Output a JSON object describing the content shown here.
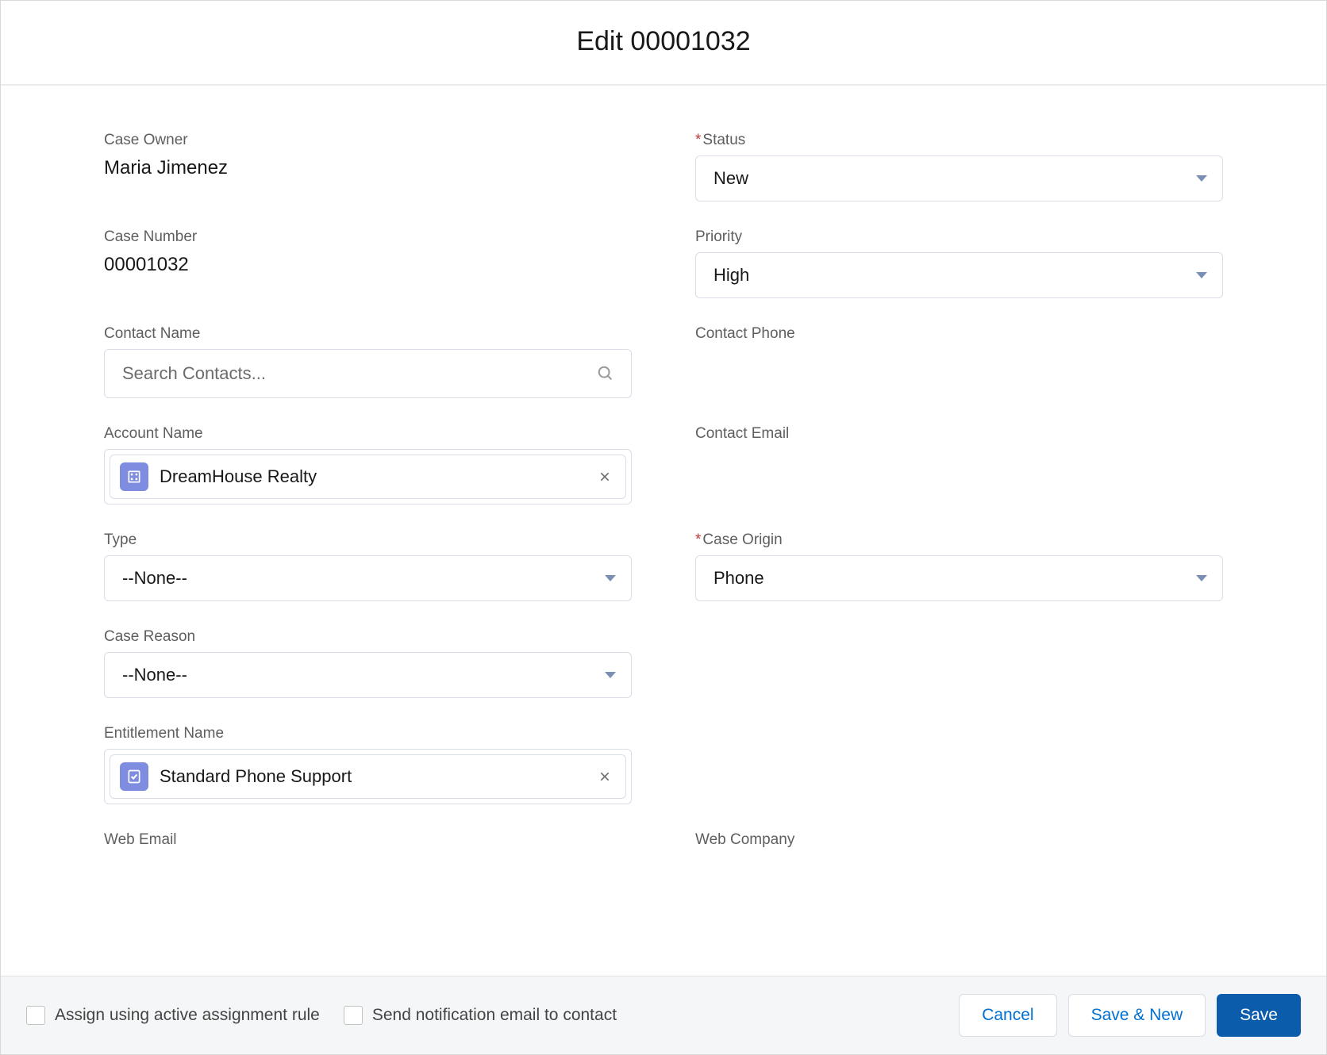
{
  "header": {
    "title": "Edit 00001032"
  },
  "fields": {
    "case_owner": {
      "label": "Case Owner",
      "value": "Maria Jimenez"
    },
    "status": {
      "label": "Status",
      "value": "New",
      "required": true
    },
    "case_number": {
      "label": "Case Number",
      "value": "00001032"
    },
    "priority": {
      "label": "Priority",
      "value": "High"
    },
    "contact_name": {
      "label": "Contact Name",
      "placeholder": "Search Contacts..."
    },
    "contact_phone": {
      "label": "Contact Phone",
      "value": ""
    },
    "account_name": {
      "label": "Account Name",
      "value": "DreamHouse Realty"
    },
    "contact_email": {
      "label": "Contact Email",
      "value": ""
    },
    "type": {
      "label": "Type",
      "value": "--None--"
    },
    "case_origin": {
      "label": "Case Origin",
      "value": "Phone",
      "required": true
    },
    "case_reason": {
      "label": "Case Reason",
      "value": "--None--"
    },
    "entitlement_name": {
      "label": "Entitlement Name",
      "value": "Standard Phone Support"
    },
    "web_email": {
      "label": "Web Email"
    },
    "web_company": {
      "label": "Web Company"
    }
  },
  "footer": {
    "assign_label": "Assign using active assignment rule",
    "notify_label": "Send notification email to contact",
    "cancel": "Cancel",
    "save_new": "Save & New",
    "save": "Save"
  }
}
